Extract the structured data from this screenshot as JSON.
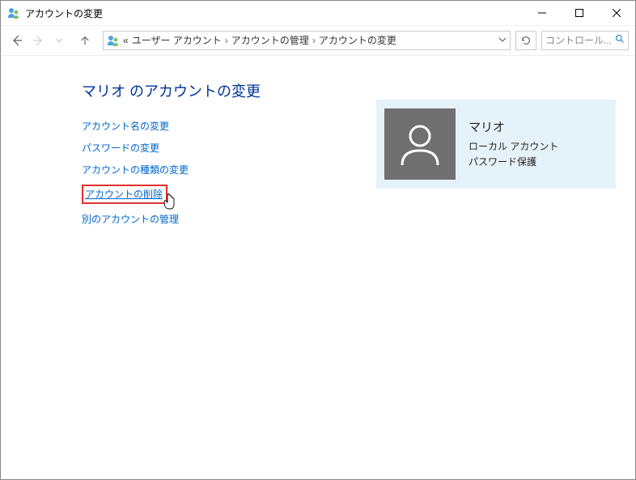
{
  "window": {
    "title": "アカウントの変更"
  },
  "address": {
    "prefix": "«",
    "crumbs": [
      "ユーザー アカウント",
      "アカウントの管理",
      "アカウントの変更"
    ]
  },
  "search": {
    "placeholder": "コントロール..."
  },
  "page": {
    "heading": "マリオ のアカウントの変更",
    "links": {
      "rename": "アカウント名の変更",
      "password": "パスワードの変更",
      "type": "アカウントの種類の変更",
      "delete": "アカウントの削除",
      "other": "別のアカウントの管理"
    }
  },
  "account": {
    "name": "マリオ",
    "type": "ローカル アカウント",
    "protection": "パスワード保護"
  }
}
